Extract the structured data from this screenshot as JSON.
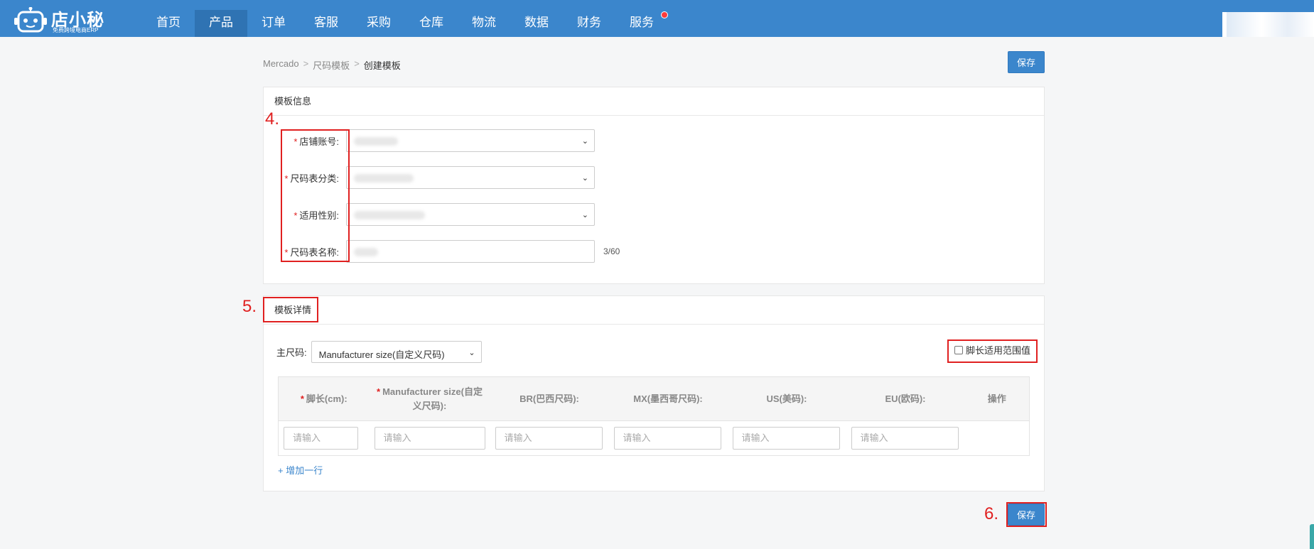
{
  "app": {
    "brand": "店小秘",
    "slogan": "免费跨境电商ERP"
  },
  "nav": {
    "items": [
      {
        "label": "首页"
      },
      {
        "label": "产品"
      },
      {
        "label": "订单"
      },
      {
        "label": "客服"
      },
      {
        "label": "采购"
      },
      {
        "label": "仓库"
      },
      {
        "label": "物流"
      },
      {
        "label": "数据"
      },
      {
        "label": "财务"
      },
      {
        "label": "服务"
      }
    ],
    "active_index": 1
  },
  "breadcrumb": {
    "items": [
      "Mercado",
      "尺码模板",
      "创建模板"
    ],
    "separator": ">"
  },
  "actions": {
    "save_label": "保存"
  },
  "template_info": {
    "title": "模板信息",
    "fields": [
      {
        "label": "店铺账号:",
        "required": true,
        "type": "select"
      },
      {
        "label": "尺码表分类:",
        "required": true,
        "type": "select"
      },
      {
        "label": "适用性别:",
        "required": true,
        "type": "select"
      },
      {
        "label": "尺码表名称:",
        "required": true,
        "type": "text",
        "counter": "3/60"
      }
    ]
  },
  "template_details": {
    "title": "模板详情",
    "main_size_label": "主尺码:",
    "main_size_value": "Manufacturer size(自定义尺码)",
    "foot_range_label": "脚长适用范围值",
    "table": {
      "columns": [
        {
          "line1": "脚长(cm):",
          "line2": "",
          "required": true
        },
        {
          "line1": "Manufacturer size(自定",
          "line2": "义尺码):",
          "required": true
        },
        {
          "line1": "BR(巴西尺码):",
          "line2": "",
          "required": false
        },
        {
          "line1": "MX(墨西哥尺码):",
          "line2": "",
          "required": false
        },
        {
          "line1": "US(美码):",
          "line2": "",
          "required": false
        },
        {
          "line1": "EU(欧码):",
          "line2": "",
          "required": false
        },
        {
          "line1": "操作",
          "line2": "",
          "required": false
        }
      ],
      "input_placeholder": "请输入"
    },
    "add_row_label": "+ 增加一行"
  },
  "annotations": {
    "step4": "4.",
    "step5": "5.",
    "step6": "6."
  },
  "colors": {
    "nav_bg": "#3b86cc",
    "nav_active": "#2f73b3",
    "primary": "#3b86cc",
    "annotation_red": "#e02020"
  }
}
